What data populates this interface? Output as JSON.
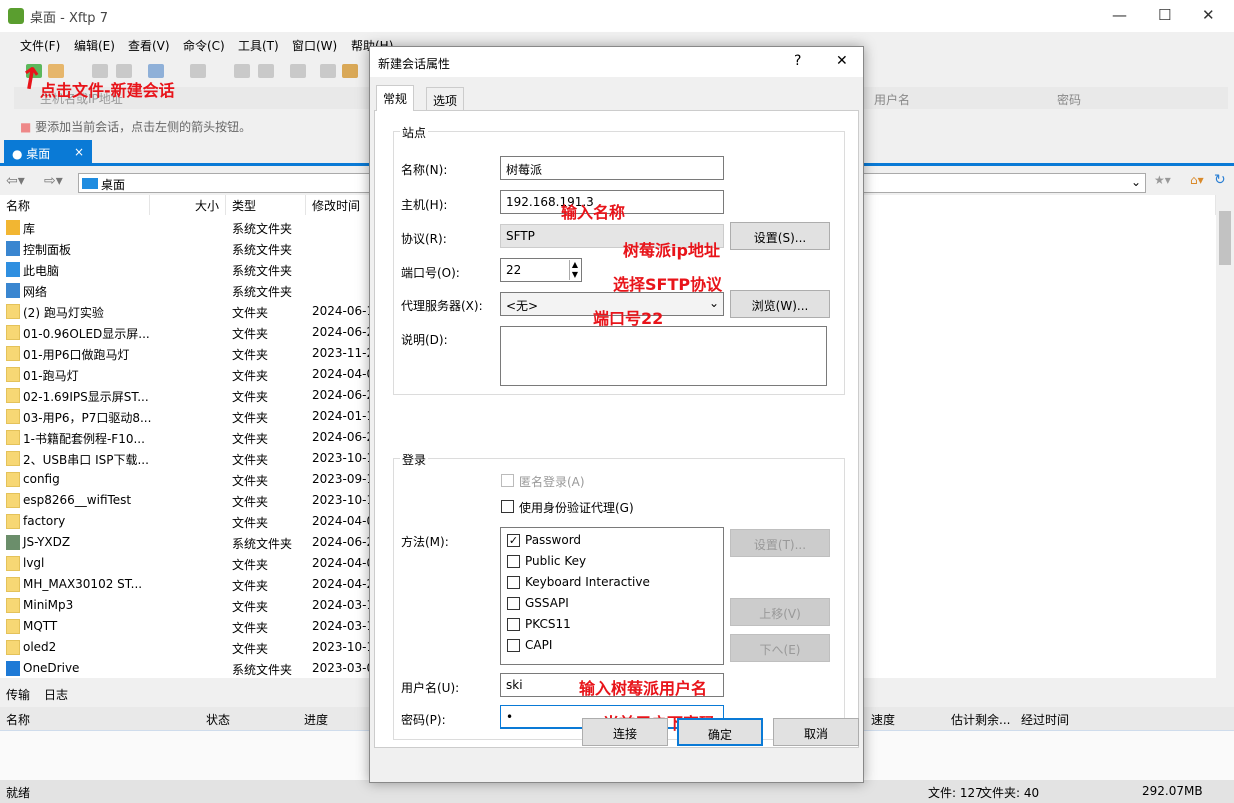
{
  "window": {
    "title": "桌面 - Xftp 7"
  },
  "menu": [
    "文件(F)",
    "编辑(E)",
    "查看(V)",
    "命令(C)",
    "工具(T)",
    "窗口(W)",
    "帮助(H)"
  ],
  "address": {
    "placeholder": "主机名或IP地址",
    "user_col": "用户名",
    "pass_col": "密码"
  },
  "hint": "要添加当前会话，点击左侧的箭头按钮。",
  "tab": {
    "label": "桌面",
    "close": "×"
  },
  "path": "桌面",
  "columns": [
    "名称",
    "大小",
    "类型",
    "修改时间"
  ],
  "files": [
    {
      "name": "库",
      "type": "系统文件夹",
      "date": "",
      "icon": "library-icon"
    },
    {
      "name": "控制面板",
      "type": "系统文件夹",
      "date": "",
      "icon": "control-panel-icon"
    },
    {
      "name": "此电脑",
      "type": "系统文件夹",
      "date": "",
      "icon": "computer-icon"
    },
    {
      "name": "网络",
      "type": "系统文件夹",
      "date": "",
      "icon": "network-icon"
    },
    {
      "name": "(2)  跑马灯实验",
      "type": "文件夹",
      "date": "2024-06-1",
      "icon": "folder-icon"
    },
    {
      "name": "01-0.96OLED显示屏...",
      "type": "文件夹",
      "date": "2024-06-2",
      "icon": "folder-icon"
    },
    {
      "name": "01-用P6口做跑马灯",
      "type": "文件夹",
      "date": "2023-11-2",
      "icon": "folder-icon"
    },
    {
      "name": "01-跑马灯",
      "type": "文件夹",
      "date": "2024-04-0",
      "icon": "folder-icon"
    },
    {
      "name": "02-1.69IPS显示屏ST...",
      "type": "文件夹",
      "date": "2024-06-2",
      "icon": "folder-icon"
    },
    {
      "name": "03-用P6，P7口驱动8...",
      "type": "文件夹",
      "date": "2024-01-1",
      "icon": "folder-icon"
    },
    {
      "name": "1-书籍配套例程-F10...",
      "type": "文件夹",
      "date": "2024-06-2",
      "icon": "folder-icon"
    },
    {
      "name": "2、USB串口 ISP下载...",
      "type": "文件夹",
      "date": "2023-10-1",
      "icon": "folder-icon"
    },
    {
      "name": "config",
      "type": "文件夹",
      "date": "2023-09-1",
      "icon": "folder-icon"
    },
    {
      "name": "esp8266__wifiTest",
      "type": "文件夹",
      "date": "2023-10-1",
      "icon": "folder-icon"
    },
    {
      "name": "factory",
      "type": "文件夹",
      "date": "2024-04-0",
      "icon": "folder-icon"
    },
    {
      "name": "JS-YXDZ",
      "type": "系统文件夹",
      "date": "2024-06-2",
      "icon": "user-icon"
    },
    {
      "name": "lvgl",
      "type": "文件夹",
      "date": "2024-04-0",
      "icon": "folder-icon"
    },
    {
      "name": "MH_MAX30102 ST...",
      "type": "文件夹",
      "date": "2024-04-2",
      "icon": "folder-icon"
    },
    {
      "name": "MiniMp3",
      "type": "文件夹",
      "date": "2024-03-1",
      "icon": "folder-icon"
    },
    {
      "name": "MQTT",
      "type": "文件夹",
      "date": "2024-03-1",
      "icon": "folder-icon"
    },
    {
      "name": "oled2",
      "type": "文件夹",
      "date": "2023-10-1",
      "icon": "folder-icon"
    },
    {
      "name": "OneDrive",
      "type": "系统文件夹",
      "date": "2023-03-0",
      "icon": "onedrive-icon"
    }
  ],
  "bottom": {
    "tabs": [
      "传输",
      "日志"
    ],
    "columns": [
      "名称",
      "状态",
      "进度",
      "速度",
      "估计剩余...",
      "经过时间"
    ]
  },
  "status": {
    "left": "就绪",
    "files": "文件: 127",
    "folders": "文件夹: 40",
    "size": "292.07MB"
  },
  "dialog": {
    "title": "新建会话属性",
    "help": "?",
    "close": "✕",
    "tabs": [
      "常规",
      "选项"
    ],
    "site_group": "站点",
    "name_label": "名称(N):",
    "name_value": "树莓派",
    "host_label": "主机(H):",
    "host_value": "192.168.191.3",
    "protocol_label": "协议(R):",
    "protocol_value": "SFTP",
    "settings_btn": "设置(S)...",
    "port_label": "端口号(O):",
    "port_value": "22",
    "proxy_label": "代理服务器(X):",
    "proxy_value": "<无>",
    "browse_btn": "浏览(W)...",
    "desc_label": "说明(D):",
    "login_group": "登录",
    "anon": "匿名登录(A)",
    "agent": "使用身份验证代理(G)",
    "method_label": "方法(M):",
    "methods": [
      {
        "label": "Password",
        "checked": true
      },
      {
        "label": "Public Key",
        "checked": false
      },
      {
        "label": "Keyboard Interactive",
        "checked": false
      },
      {
        "label": "GSSAPI",
        "checked": false
      },
      {
        "label": "PKCS11",
        "checked": false
      },
      {
        "label": "CAPI",
        "checked": false
      }
    ],
    "method_settings": "设置(T)...",
    "up": "上移(V)",
    "down": "下へ(E)",
    "user_label": "用户名(U):",
    "user_value": "ski",
    "pass_label": "密码(P):",
    "pass_value": "•",
    "connect": "连接",
    "ok": "确定",
    "cancel": "取消"
  },
  "annotations": {
    "file_new": "点击文件-新建会话",
    "name": "输入名称",
    "host": "树莓派ip地址",
    "protocol": "选择SFTP协议",
    "port": "端口号22",
    "user": "输入树莓派用户名",
    "pass": "当前用户下密码",
    "color": "#e8141a"
  }
}
